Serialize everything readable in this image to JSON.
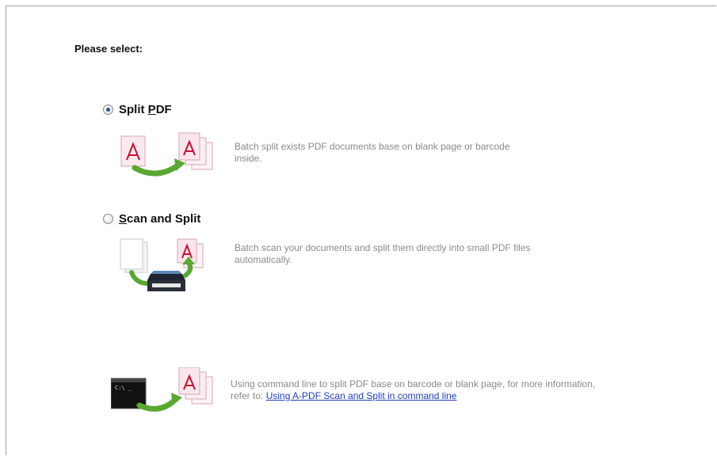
{
  "prompt": "Please select:",
  "options": [
    {
      "label_pre": "Split ",
      "label_mnemonic": "P",
      "label_post": "DF",
      "checked": true,
      "description": "Batch split exists PDF documents base on blank page or barcode inside."
    },
    {
      "label_pre": "",
      "label_mnemonic": "S",
      "label_post": "can and Split",
      "checked": false,
      "description": "Batch scan your documents and split them directly into small PDF files automatically."
    }
  ],
  "command_line": {
    "text": "Using command line to split PDF base on barcode or blank page, for more information, refer to:",
    "link": "Using A-PDF Scan and Split in command line",
    "console_text": "C:\\ _"
  },
  "colors": {
    "pdf_red": "#c8102e",
    "arrow_green": "#5aa832",
    "link_blue": "#1f3fbf",
    "desc_gray": "#8a8a8a"
  },
  "icons": [
    "pdf-split-illustration",
    "scanner-split-illustration",
    "command-line-illustration"
  ]
}
